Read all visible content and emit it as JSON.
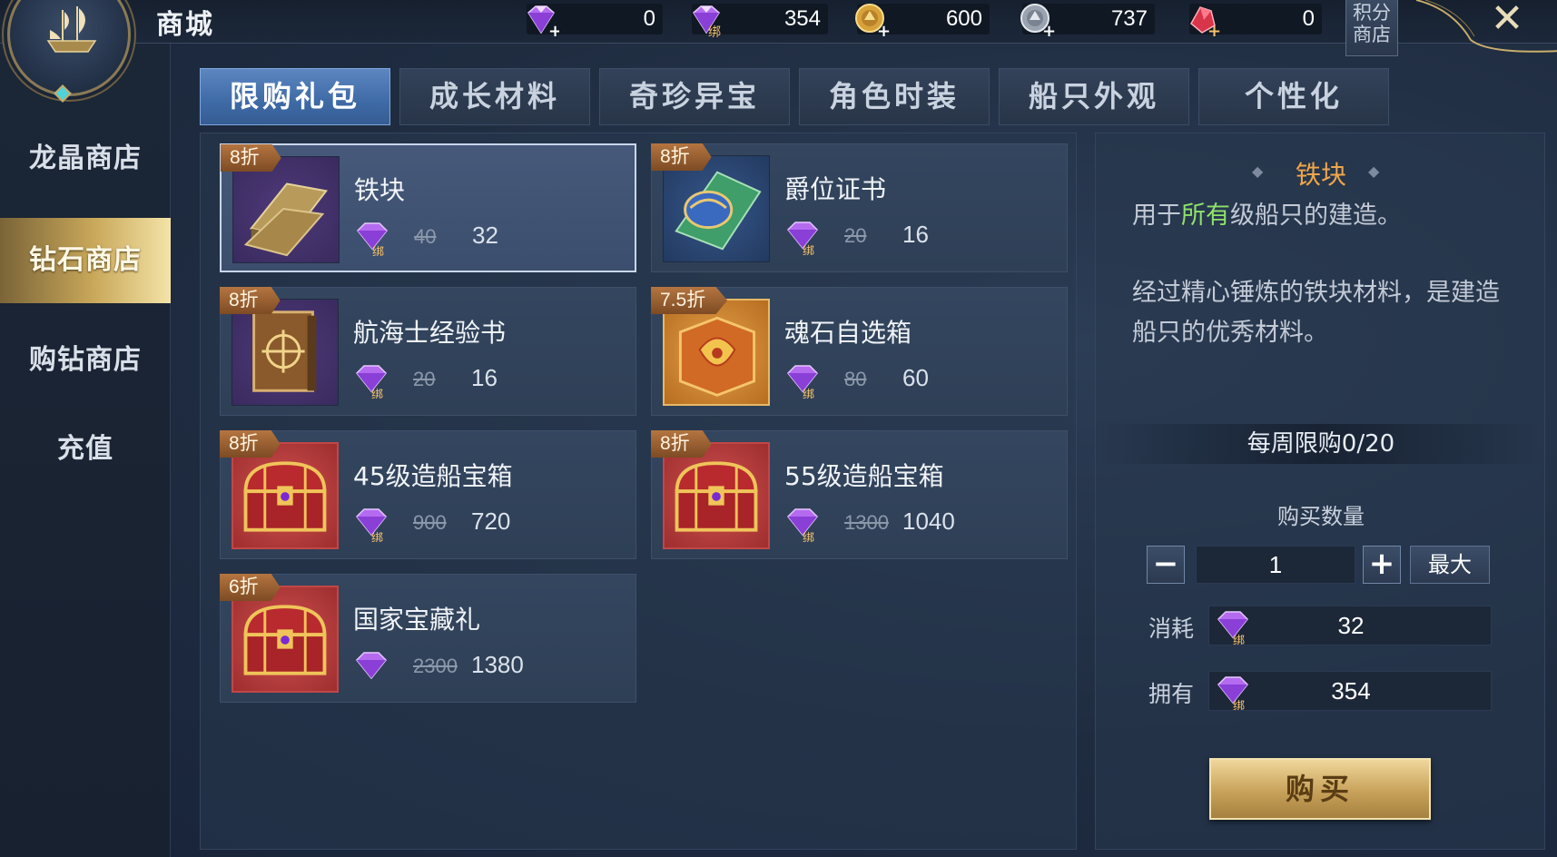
{
  "header": {
    "title": "商城",
    "points_shop_label": "积分商店"
  },
  "currencies": [
    {
      "icon": "diamond-icon",
      "value": "0"
    },
    {
      "icon": "bound-diamond-icon",
      "value": "354",
      "badge": "绑"
    },
    {
      "icon": "gold-coin-icon",
      "value": "600"
    },
    {
      "icon": "silver-coin-icon",
      "value": "737"
    },
    {
      "icon": "ruby-icon",
      "value": "0"
    }
  ],
  "sidebar": {
    "items": [
      {
        "label": "龙晶商店"
      },
      {
        "label": "钻石商店"
      },
      {
        "label": "购钻商店"
      },
      {
        "label": "充值"
      }
    ]
  },
  "tabs": [
    {
      "label": "限购礼包"
    },
    {
      "label": "成长材料"
    },
    {
      "label": "奇珍异宝"
    },
    {
      "label": "角色时装"
    },
    {
      "label": "船只外观"
    },
    {
      "label": "个性化"
    }
  ],
  "items": [
    {
      "name": "铁块",
      "discount": "8折",
      "old_price": "40",
      "price": "32",
      "currency_badge": "绑",
      "thumb": "iron-ingot-icon"
    },
    {
      "name": "爵位证书",
      "discount": "8折",
      "old_price": "20",
      "price": "16",
      "currency_badge": "绑",
      "thumb": "certificate-icon"
    },
    {
      "name": "航海士经验书",
      "discount": "8折",
      "old_price": "20",
      "price": "16",
      "currency_badge": "绑",
      "thumb": "exp-book-icon"
    },
    {
      "name": "魂石自选箱",
      "discount": "7.5折",
      "old_price": "80",
      "price": "60",
      "currency_badge": "绑",
      "thumb": "soulstone-box-icon"
    },
    {
      "name": "45级造船宝箱",
      "discount": "8折",
      "old_price": "900",
      "price": "720",
      "currency_badge": "绑",
      "thumb": "treasure-chest-icon"
    },
    {
      "name": "55级造船宝箱",
      "discount": "8折",
      "old_price": "1300",
      "price": "1040",
      "currency_badge": "绑",
      "thumb": "treasure-chest-icon"
    },
    {
      "name": "国家宝藏礼",
      "discount": "6折",
      "old_price": "2300",
      "price": "1380",
      "currency_badge": "",
      "thumb": "treasure-chest-icon"
    }
  ],
  "detail": {
    "title": "铁块",
    "desc_prefix": "用于",
    "desc_highlight": "所有",
    "desc_suffix": "级船只的建造。",
    "desc2": "经过精心锤炼的铁块材料，是建造船只的优秀材料。",
    "weekly_limit": "每周限购0/20",
    "qty_label": "购买数量",
    "quantity": "1",
    "max_label": "最大",
    "cost_label": "消耗",
    "cost_value": "32",
    "own_label": "拥有",
    "own_value": "354",
    "buy_label": "购买",
    "gem_badge": "绑"
  },
  "colors": {
    "highlight_green": "#8fe36a",
    "title_orange": "#f0a64a",
    "active_tab": "#4a77b4",
    "active_nav_gold": "#c9a85a"
  }
}
